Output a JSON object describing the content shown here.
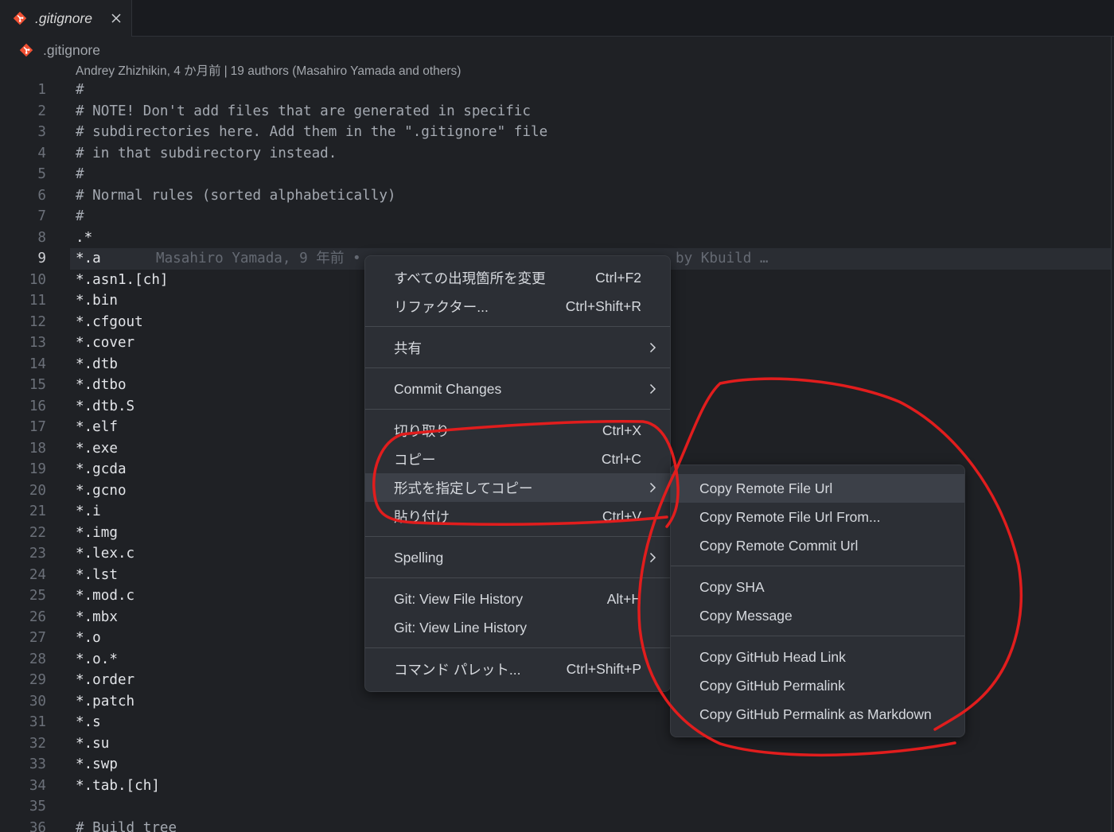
{
  "theme": {
    "git_icon": "#f05033",
    "annotation": "#e11d1d"
  },
  "tab": {
    "title": ".gitignore",
    "icon": "git-file-icon",
    "close_icon": "close-icon"
  },
  "breadcrumb": {
    "file": ".gitignore",
    "icon": "git-file-icon"
  },
  "codelens": {
    "recent_change": "Andrey Zhizhikin, 4 か月前",
    "separator": "|",
    "authors": "19 authors (Masahiro Yamada and others)"
  },
  "editor": {
    "current_line": 9,
    "blame": {
      "left": "Masahiro Yamada, 9 年前 •",
      "right": "by Kbuild …"
    },
    "lines": [
      {
        "n": 1,
        "text": "#"
      },
      {
        "n": 2,
        "text": "# NOTE! Don't add files that are generated in specific"
      },
      {
        "n": 3,
        "text": "# subdirectories here. Add them in the \".gitignore\" file"
      },
      {
        "n": 4,
        "text": "# in that subdirectory instead."
      },
      {
        "n": 5,
        "text": "#"
      },
      {
        "n": 6,
        "text": "# Normal rules (sorted alphabetically)"
      },
      {
        "n": 7,
        "text": "#"
      },
      {
        "n": 8,
        "text": ".*"
      },
      {
        "n": 9,
        "text": "*.a"
      },
      {
        "n": 10,
        "text": "*.asn1.[ch]"
      },
      {
        "n": 11,
        "text": "*.bin"
      },
      {
        "n": 12,
        "text": "*.cfgout"
      },
      {
        "n": 13,
        "text": "*.cover"
      },
      {
        "n": 14,
        "text": "*.dtb"
      },
      {
        "n": 15,
        "text": "*.dtbo"
      },
      {
        "n": 16,
        "text": "*.dtb.S"
      },
      {
        "n": 17,
        "text": "*.elf"
      },
      {
        "n": 18,
        "text": "*.exe"
      },
      {
        "n": 19,
        "text": "*.gcda"
      },
      {
        "n": 20,
        "text": "*.gcno"
      },
      {
        "n": 21,
        "text": "*.i"
      },
      {
        "n": 22,
        "text": "*.img"
      },
      {
        "n": 23,
        "text": "*.lex.c"
      },
      {
        "n": 24,
        "text": "*.lst"
      },
      {
        "n": 25,
        "text": "*.mod.c"
      },
      {
        "n": 26,
        "text": "*.mbx"
      },
      {
        "n": 27,
        "text": "*.o"
      },
      {
        "n": 28,
        "text": "*.o.*"
      },
      {
        "n": 29,
        "text": "*.order"
      },
      {
        "n": 30,
        "text": "*.patch"
      },
      {
        "n": 31,
        "text": "*.s"
      },
      {
        "n": 32,
        "text": "*.su"
      },
      {
        "n": 33,
        "text": "*.swp"
      },
      {
        "n": 34,
        "text": "*.tab.[ch]"
      },
      {
        "n": 35,
        "text": ""
      },
      {
        "n": 36,
        "text": "# Build tree"
      }
    ]
  },
  "context_menu": {
    "items": [
      {
        "label": "すべての出現箇所を変更",
        "shortcut": "Ctrl+F2"
      },
      {
        "label": "リファクター...",
        "shortcut": "Ctrl+Shift+R"
      },
      {
        "label": "共有",
        "submenu": true
      },
      {
        "label": "Commit Changes",
        "submenu": true
      },
      {
        "label": "切り取り",
        "shortcut": "Ctrl+X"
      },
      {
        "label": "コピー",
        "shortcut": "Ctrl+C"
      },
      {
        "label": "形式を指定してコピー",
        "submenu": true
      },
      {
        "label": "貼り付け",
        "shortcut": "Ctrl+V"
      },
      {
        "label": "Spelling",
        "submenu": true
      },
      {
        "label": "Git: View File History",
        "shortcut": "Alt+H"
      },
      {
        "label": "Git: View Line History"
      },
      {
        "label": "コマンド パレット...",
        "shortcut": "Ctrl+Shift+P"
      }
    ]
  },
  "copy_as_submenu": {
    "items": [
      {
        "label": "Copy Remote File Url"
      },
      {
        "label": "Copy Remote File Url From..."
      },
      {
        "label": "Copy Remote Commit Url"
      },
      {
        "label": "Copy SHA"
      },
      {
        "label": "Copy Message"
      },
      {
        "label": "Copy GitHub Head Link"
      },
      {
        "label": "Copy GitHub Permalink"
      },
      {
        "label": "Copy GitHub Permalink as Markdown"
      }
    ]
  }
}
